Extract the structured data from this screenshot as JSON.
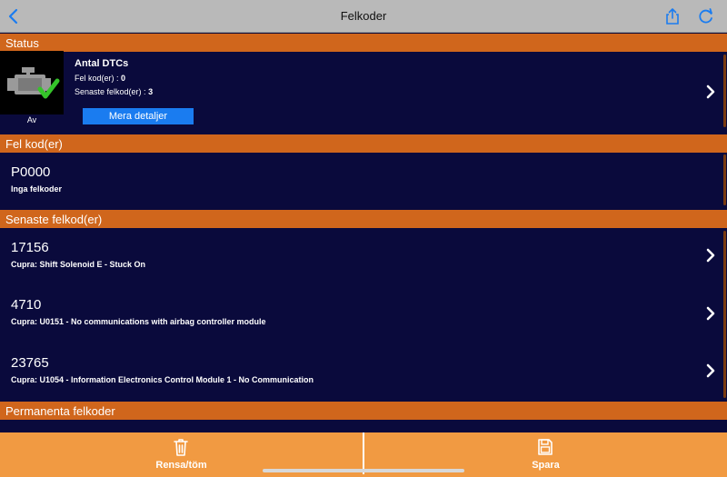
{
  "navbar": {
    "title": "Felkoder",
    "back_icon": "chevron-left-icon",
    "share_icon": "share-icon",
    "refresh_icon": "refresh-icon",
    "accent": "#1a7cf0"
  },
  "sections": {
    "status": "Status",
    "fault_codes": "Fel kod(er)",
    "recent_codes": "Senaste felkod(er)",
    "permanent_codes": "Permanenta felkoder"
  },
  "status_card": {
    "thumb_label": "Av",
    "title": "Antal DTCs",
    "fault_count_label": "Fel kod(er) :",
    "fault_count": "0",
    "recent_count_label": "Senaste felkod(er) :",
    "recent_count": "3",
    "details_button": "Mera detaljer"
  },
  "fault_codes": [
    {
      "code": "P0000",
      "description": "Inga felkoder"
    }
  ],
  "recent_codes": [
    {
      "code": "17156",
      "description": "Cupra: Shift Solenoid E - Stuck On"
    },
    {
      "code": "4710",
      "description": "Cupra: U0151 - No communications with airbag controller module"
    },
    {
      "code": "23765",
      "description": "Cupra: U1054 - Information Electronics Control Module 1 - No Communication"
    }
  ],
  "toolbar": {
    "clear_label": "Rensa/töm",
    "save_label": "Spara"
  },
  "colors": {
    "header_orange": "#d0661c",
    "toolbar_orange": "#f19a42",
    "row_background": "#0a0a3c",
    "button_blue": "#1a7cf0",
    "check_green": "#35c42a"
  }
}
